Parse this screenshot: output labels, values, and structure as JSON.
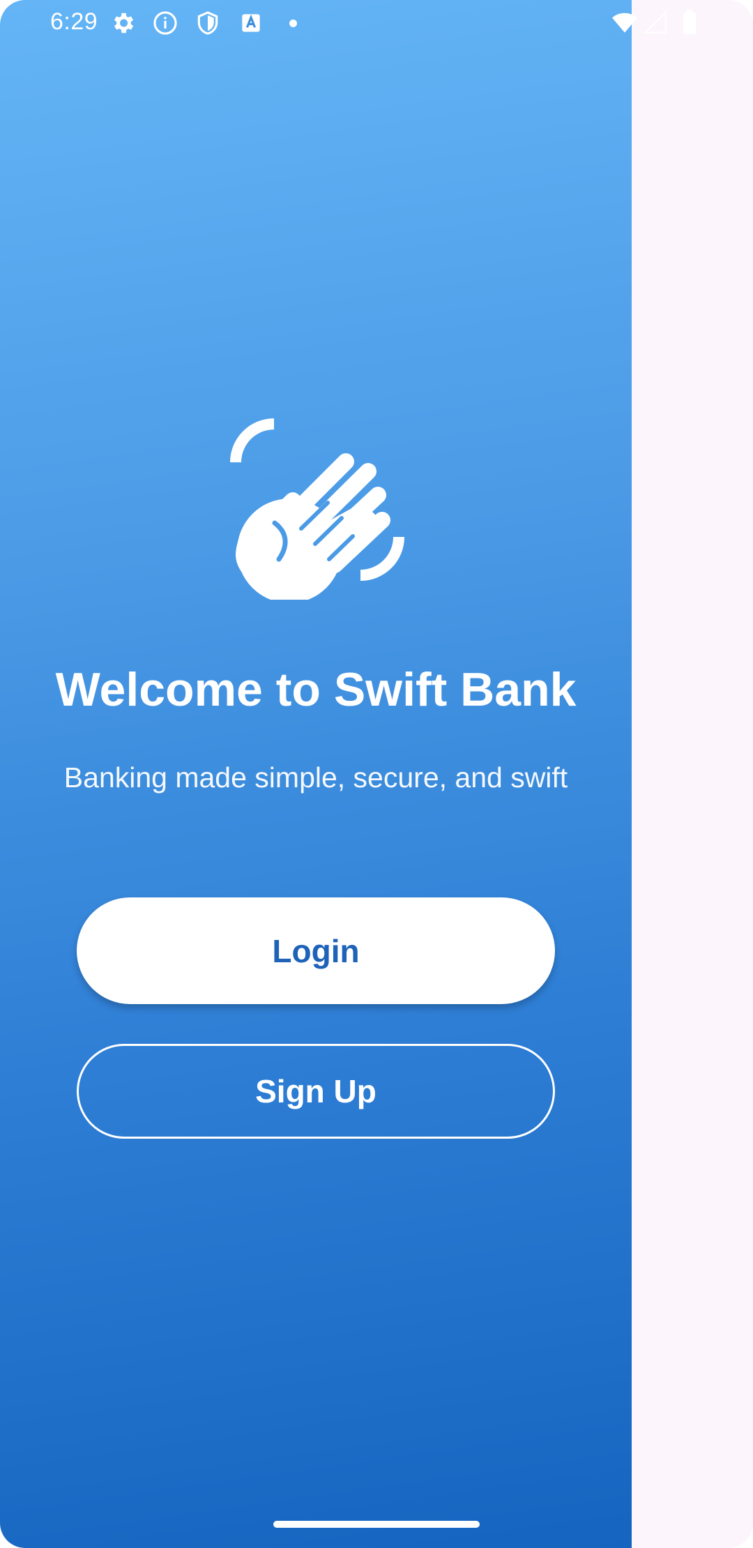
{
  "status_bar": {
    "time": "6:29",
    "icons": [
      "settings-icon",
      "info-icon",
      "shield-icon",
      "text-a-icon",
      "notification-dot",
      "wifi-icon",
      "signal-icon",
      "battery-icon"
    ]
  },
  "welcome": {
    "logo_icon": "waving-hand-icon",
    "title": "Welcome to Swift Bank",
    "subtitle": "Banking made simple, secure, and swift"
  },
  "actions": {
    "login_label": "Login",
    "signup_label": "Sign Up"
  },
  "colors": {
    "gradient_top": "#64b5f6",
    "gradient_bottom": "#1565c0",
    "login_text": "#1e63b8",
    "side_background": "#fdf5fc"
  }
}
